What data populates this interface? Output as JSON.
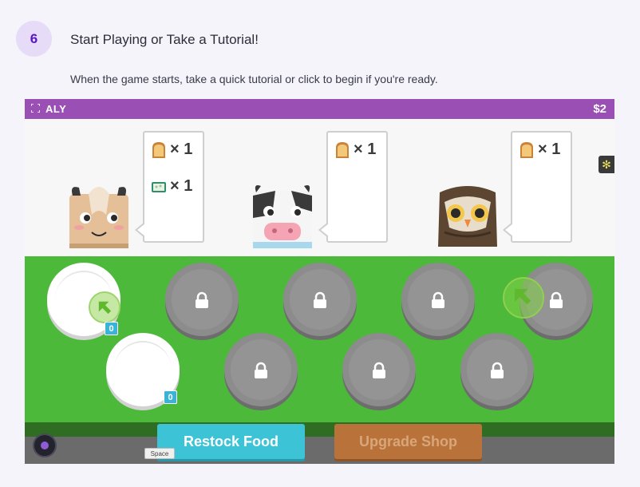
{
  "step": {
    "number": "6",
    "title": "Start Playing or Take a Tutorial!",
    "description": "When the game starts, take a quick tutorial or click to begin if you're ready."
  },
  "game": {
    "player_name": "ALY",
    "money": "$2",
    "customers": [
      {
        "animal": "goat",
        "orders": [
          {
            "icon": "toast-icon",
            "qty": "× 1"
          },
          {
            "icon": "cheese-icon",
            "qty": "× 1"
          }
        ]
      },
      {
        "animal": "cow",
        "orders": [
          {
            "icon": "toast-icon",
            "qty": "× 1"
          }
        ]
      },
      {
        "animal": "owl",
        "orders": [
          {
            "icon": "toast-icon",
            "qty": "× 1"
          }
        ]
      }
    ],
    "plates": {
      "unlocked_counts": [
        "0",
        "0"
      ],
      "locked_count": 7
    },
    "buttons": {
      "restock": "Restock Food",
      "upgrade": "Upgrade Shop",
      "space_hint": "Space"
    },
    "colors": {
      "topbar": "#9a4fb5",
      "field": "#4cb93a",
      "restock": "#3cc3d6",
      "upgrade": "#b8723a"
    }
  }
}
